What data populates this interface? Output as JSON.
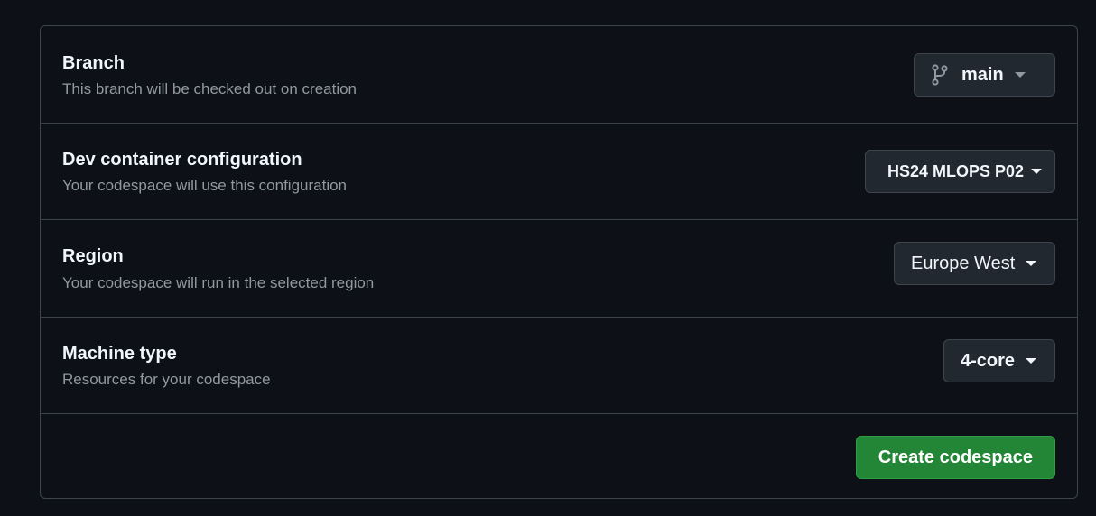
{
  "branch": {
    "title": "Branch",
    "description": "This branch will be checked out on creation",
    "selected": "main",
    "icon": "git-branch-icon"
  },
  "dev_container": {
    "title": "Dev container configuration",
    "description": "Your codespace will use this configuration",
    "selected": "HS24 MLOPS P02"
  },
  "region": {
    "title": "Region",
    "description": "Your codespace will run in the selected region",
    "selected": "Europe West"
  },
  "machine_type": {
    "title": "Machine type",
    "description": "Resources for your codespace",
    "selected": "4-core"
  },
  "actions": {
    "create_label": "Create codespace"
  },
  "colors": {
    "background": "#0d1117",
    "border": "#3d444d",
    "button_bg": "#212830",
    "primary_green": "#238636",
    "text_primary": "#f0f6fc",
    "text_muted": "#9198a1"
  }
}
